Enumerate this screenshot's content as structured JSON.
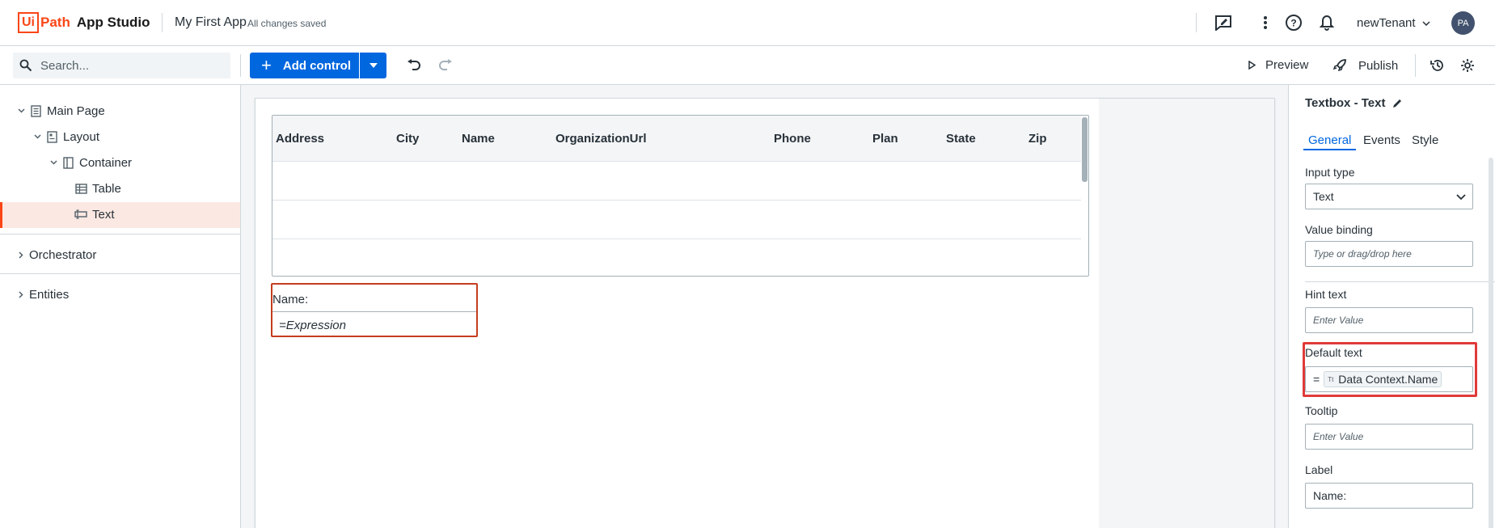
{
  "header": {
    "logo_box": "Ui",
    "logo_path": "Path",
    "product": "App Studio",
    "app_name": "My First App",
    "save_status": "All changes saved",
    "tenant": "newTenant",
    "avatar_initials": "PA"
  },
  "toolbar": {
    "search_placeholder": "Search...",
    "add_control": "Add control",
    "preview": "Preview",
    "publish": "Publish"
  },
  "tree": {
    "items": [
      {
        "label": "Main Page"
      },
      {
        "label": "Layout"
      },
      {
        "label": "Container"
      },
      {
        "label": "Table"
      },
      {
        "label": "Text"
      }
    ],
    "orchestrator": "Orchestrator",
    "entities": "Entities"
  },
  "table": {
    "columns": [
      "Address",
      "City",
      "Name",
      "OrganizationUrl",
      "Phone",
      "Plan",
      "State",
      "Zip"
    ]
  },
  "textbox": {
    "label": "Name:",
    "value": "=Expression"
  },
  "properties": {
    "title": "Textbox - Text",
    "tabs": [
      "General",
      "Events",
      "Style"
    ],
    "input_type_label": "Input type",
    "input_type_value": "Text",
    "value_binding_label": "Value binding",
    "value_binding_placeholder": "Type or drag/drop here",
    "hint_text_label": "Hint text",
    "hint_text_placeholder": "Enter Value",
    "default_text_label": "Default text",
    "default_text_prefix": "=",
    "default_text_chip_icon": "Tt",
    "default_text_value": "Data Context.Name",
    "tooltip_label": "Tooltip",
    "tooltip_placeholder": "Enter Value",
    "label_label": "Label",
    "label_value": "Name:"
  },
  "colors": {
    "brand": "#fa4616",
    "primary": "#0067df",
    "highlight": "#e03a3a",
    "selection": "#c53d1f"
  }
}
